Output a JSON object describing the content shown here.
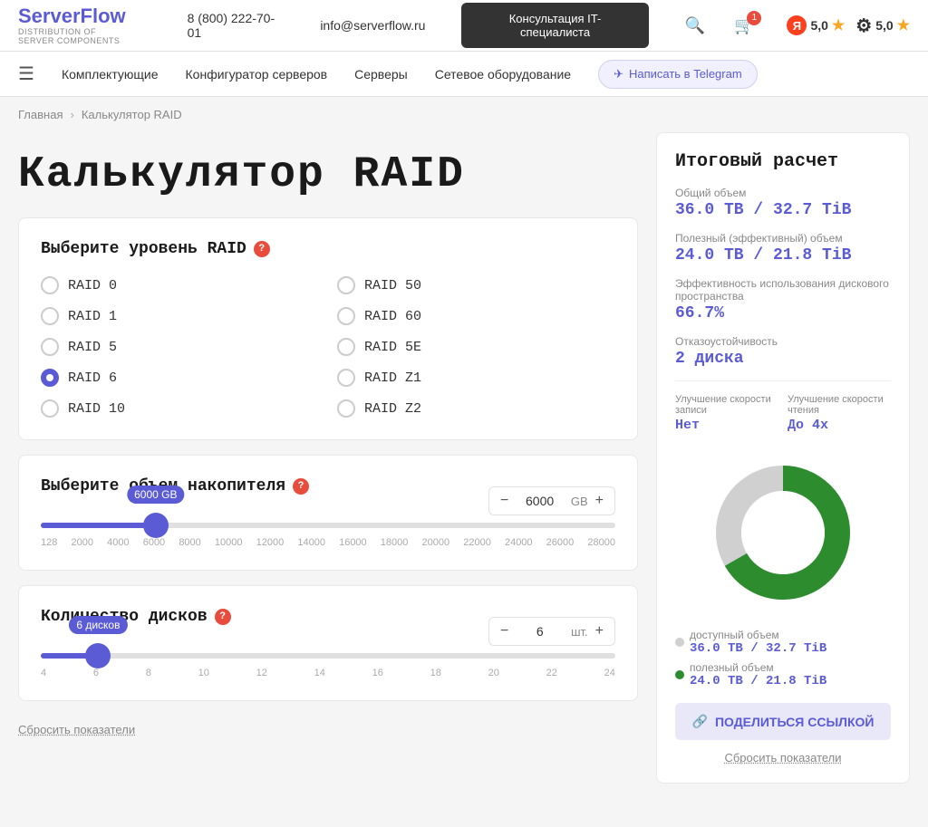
{
  "header": {
    "logo_main_1": "Server",
    "logo_main_2": "Flow",
    "logo_sub_line1": "DISTRIBUTION OF",
    "logo_sub_line2": "SERVER COMPONENTS",
    "phone": "8 (800) 222-70-01",
    "email": "info@serverflow.ru",
    "cta_button": "Консультация IT-специалиста",
    "cart_count": "1",
    "yandex_rating": "5,0",
    "google_rating": "5,0",
    "star": "★"
  },
  "nav": {
    "items": [
      {
        "label": "Комплектующие"
      },
      {
        "label": "Конфигуратор серверов"
      },
      {
        "label": "Серверы"
      },
      {
        "label": "Сетевое оборудование"
      }
    ],
    "telegram_label": "Написать в Telegram"
  },
  "breadcrumb": {
    "home": "Главная",
    "separator": "›",
    "current": "Калькулятор RAID"
  },
  "page": {
    "title": "Калькулятор RAID"
  },
  "raid_selector": {
    "title": "Выберите уровень RAID",
    "options_left": [
      {
        "id": "raid0",
        "label": "RAID 0",
        "selected": false
      },
      {
        "id": "raid1",
        "label": "RAID 1",
        "selected": false
      },
      {
        "id": "raid5",
        "label": "RAID 5",
        "selected": false
      },
      {
        "id": "raid6",
        "label": "RAID 6",
        "selected": true
      },
      {
        "id": "raid10",
        "label": "RAID 10",
        "selected": false
      }
    ],
    "options_right": [
      {
        "id": "raid50",
        "label": "RAID 50",
        "selected": false
      },
      {
        "id": "raid60",
        "label": "RAID 60",
        "selected": false
      },
      {
        "id": "raid5e",
        "label": "RAID 5E",
        "selected": false
      },
      {
        "id": "raidz1",
        "label": "RAID Z1",
        "selected": false
      },
      {
        "id": "raidz2",
        "label": "RAID Z2",
        "selected": false
      }
    ]
  },
  "disk_size": {
    "title": "Выберите объем накопителя",
    "value": "6000",
    "unit": "GB",
    "slider_percent": "20",
    "ticks": [
      "128",
      "2000",
      "4000",
      "6000",
      "8000",
      "10000",
      "12000",
      "14000",
      "16000",
      "18000",
      "20000",
      "22000",
      "24000",
      "26000",
      "28000"
    ],
    "thumb_label": "6000 GB"
  },
  "disk_count": {
    "title": "Количество дисков",
    "value": "6",
    "unit": "шт.",
    "slider_percent": "10",
    "ticks": [
      "4",
      "6",
      "8",
      "10",
      "12",
      "14",
      "16",
      "18",
      "20",
      "22",
      "24"
    ],
    "thumb_label": "6 дисков"
  },
  "reset_label": "Сбросить показатели",
  "summary": {
    "title": "Итоговый расчет",
    "total_label": "Общий объем",
    "total_value": "36.0 ТВ / 32.7 TiB",
    "useful_label": "Полезный (эффективный) объем",
    "useful_value": "24.0 ТВ / 21.8 TiB",
    "efficiency_label": "Эффективность использования дискового пространства",
    "efficiency_value": "66.7%",
    "fault_label": "Отказоустойчивость",
    "fault_value": "2 диска",
    "write_speed_label": "Улучшение скорости записи",
    "write_speed_value": "Нет",
    "read_speed_label": "Улучшение скорости чтения",
    "read_speed_value": "До 4х",
    "chart_total_label": "доступный объем",
    "chart_total_val": "36.0 ТВ / 32.7 TiB",
    "chart_useful_label": "полезный объем",
    "chart_useful_val": "24.0 ТВ / 21.8 TiB",
    "share_button": "ПОДЕЛИТЬСЯ ССЫЛКОЙ",
    "reset_label": "Сбросить показатели",
    "donut_green_pct": 66.7,
    "donut_gray_pct": 33.3
  }
}
